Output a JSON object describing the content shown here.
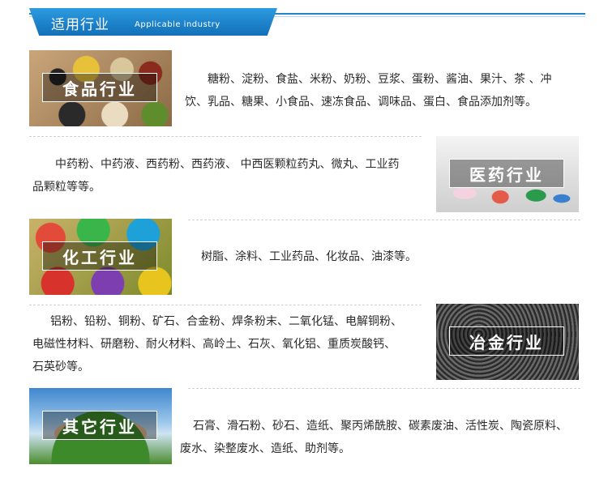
{
  "header": {
    "title": "适用行业",
    "subtitle": "Applicable industry",
    "accent_color": "#1f86c8"
  },
  "industries": [
    {
      "label": "食品行业",
      "text_line1": "糖粉、淀粉、食盐、米粉、奶粉、豆浆、蛋粉、酱油、果汁、茶 、冲",
      "text_line2": "饮、乳品、糖果、小食品、速冻食品、调味品、蛋白、食品添加剂等。"
    },
    {
      "label": "医药行业",
      "text_line1": "中药粉、中药液、西药粉、西药液、 中西医颗粒药丸、微丸、工业药",
      "text_line2": "品颗粒等等。"
    },
    {
      "label": "化工行业",
      "text_line1": "树脂、涂料、工业药品、化妆品、油漆等。"
    },
    {
      "label": "冶金行业",
      "text_line1": "铝粉、铅粉、铜粉、矿石、合金粉、焊条粉末、二氧化锰、电解铜粉、",
      "text_line2": "电磁性材料、研磨粉、耐火材料、高岭土、石灰、氧化铝、重质炭酸钙、",
      "text_line3": "石英砂等。"
    },
    {
      "label": "其它行业",
      "text_line1": "石膏、滑石粉、砂石、造纸、聚丙烯酰胺、碳素废油、活性炭、陶瓷原料、",
      "text_line2": "废水、染整废水、造纸、助剂等。"
    }
  ]
}
